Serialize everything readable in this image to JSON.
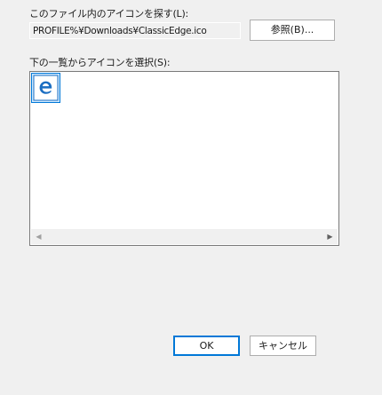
{
  "dialog": {
    "file_label": "このファイル内のアイコンを探す(L):",
    "file_path": "PROFILE%¥Downloads¥ClassicEdge.ico",
    "browse_label": "参照(B)...",
    "icons_label": "下の一覧からアイコンを選択(S):",
    "icons": [
      {
        "name": "edge-legacy-icon",
        "selected": true,
        "color": "#1b6ec2"
      }
    ],
    "scroll_left_glyph": "◀",
    "scroll_right_glyph": "▶",
    "ok_label": "OK",
    "cancel_label": "キャンセル"
  },
  "colors": {
    "background": "#f0f0f0",
    "selection_border": "#0078d7",
    "selection_fill": "#cce8ff",
    "edge_blue": "#1b6ec2"
  }
}
